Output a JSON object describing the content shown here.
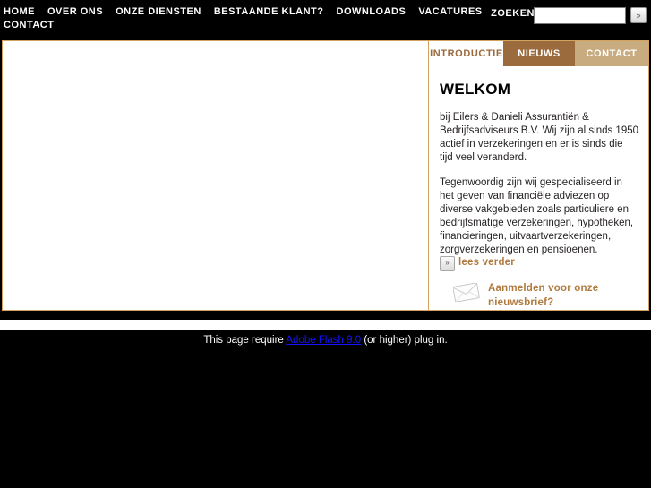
{
  "nav": {
    "items": [
      {
        "label": "HOME"
      },
      {
        "label": "OVER ONS"
      },
      {
        "label": "ONZE DIENSTEN"
      },
      {
        "label": "BESTAANDE KLANT?"
      },
      {
        "label": "DOWNLOADS"
      },
      {
        "label": "VACATURES"
      },
      {
        "label": "CONTACT"
      }
    ]
  },
  "search": {
    "label": "ZOEKEN",
    "value": "",
    "placeholder": "",
    "button_glyph": "»",
    "button_icon": "double-chevron-right-icon"
  },
  "tabs": [
    {
      "label": "INTRODUCTIE",
      "state": "active"
    },
    {
      "label": "NIEUWS",
      "state": "inactive"
    },
    {
      "label": "CONTACT",
      "state": "inactive"
    }
  ],
  "panel": {
    "title": "WELKOM",
    "paragraph1": "bij Eilers & Danieli Assurantiën & Bedrijfsadviseurs B.V. Wij zijn al sinds 1950 actief in verzekeringen en er is sinds die tijd veel veranderd.",
    "paragraph2": "Tegenwoordig zijn wij gespecialiseerd in het geven van financiële adviezen op diverse vakgebieden zoals particuliere en bedrijfsmatige verzekeringen, hypotheken, financieringen, uitvaartverzekeringen, zorgverzekeringen en pensioenen.",
    "read_more_glyph": "»",
    "read_more_label": "lees verder",
    "newsletter_label": "Aanmelden voor onze nieuwsbrief?",
    "newsletter_icon": "envelope-icon"
  },
  "footer": {
    "notice_prefix": "This page require ",
    "notice_link": "Adobe Flash 9.0",
    "notice_suffix": " (or higher) plug in."
  },
  "colors": {
    "page_bg": "#000000",
    "accent_brown": "#9b6b3d",
    "tab_light": "#c9ab80",
    "border_gold": "#d3a25e",
    "link_brown": "#b07a3e",
    "flash_link_blue": "#1414ff"
  }
}
